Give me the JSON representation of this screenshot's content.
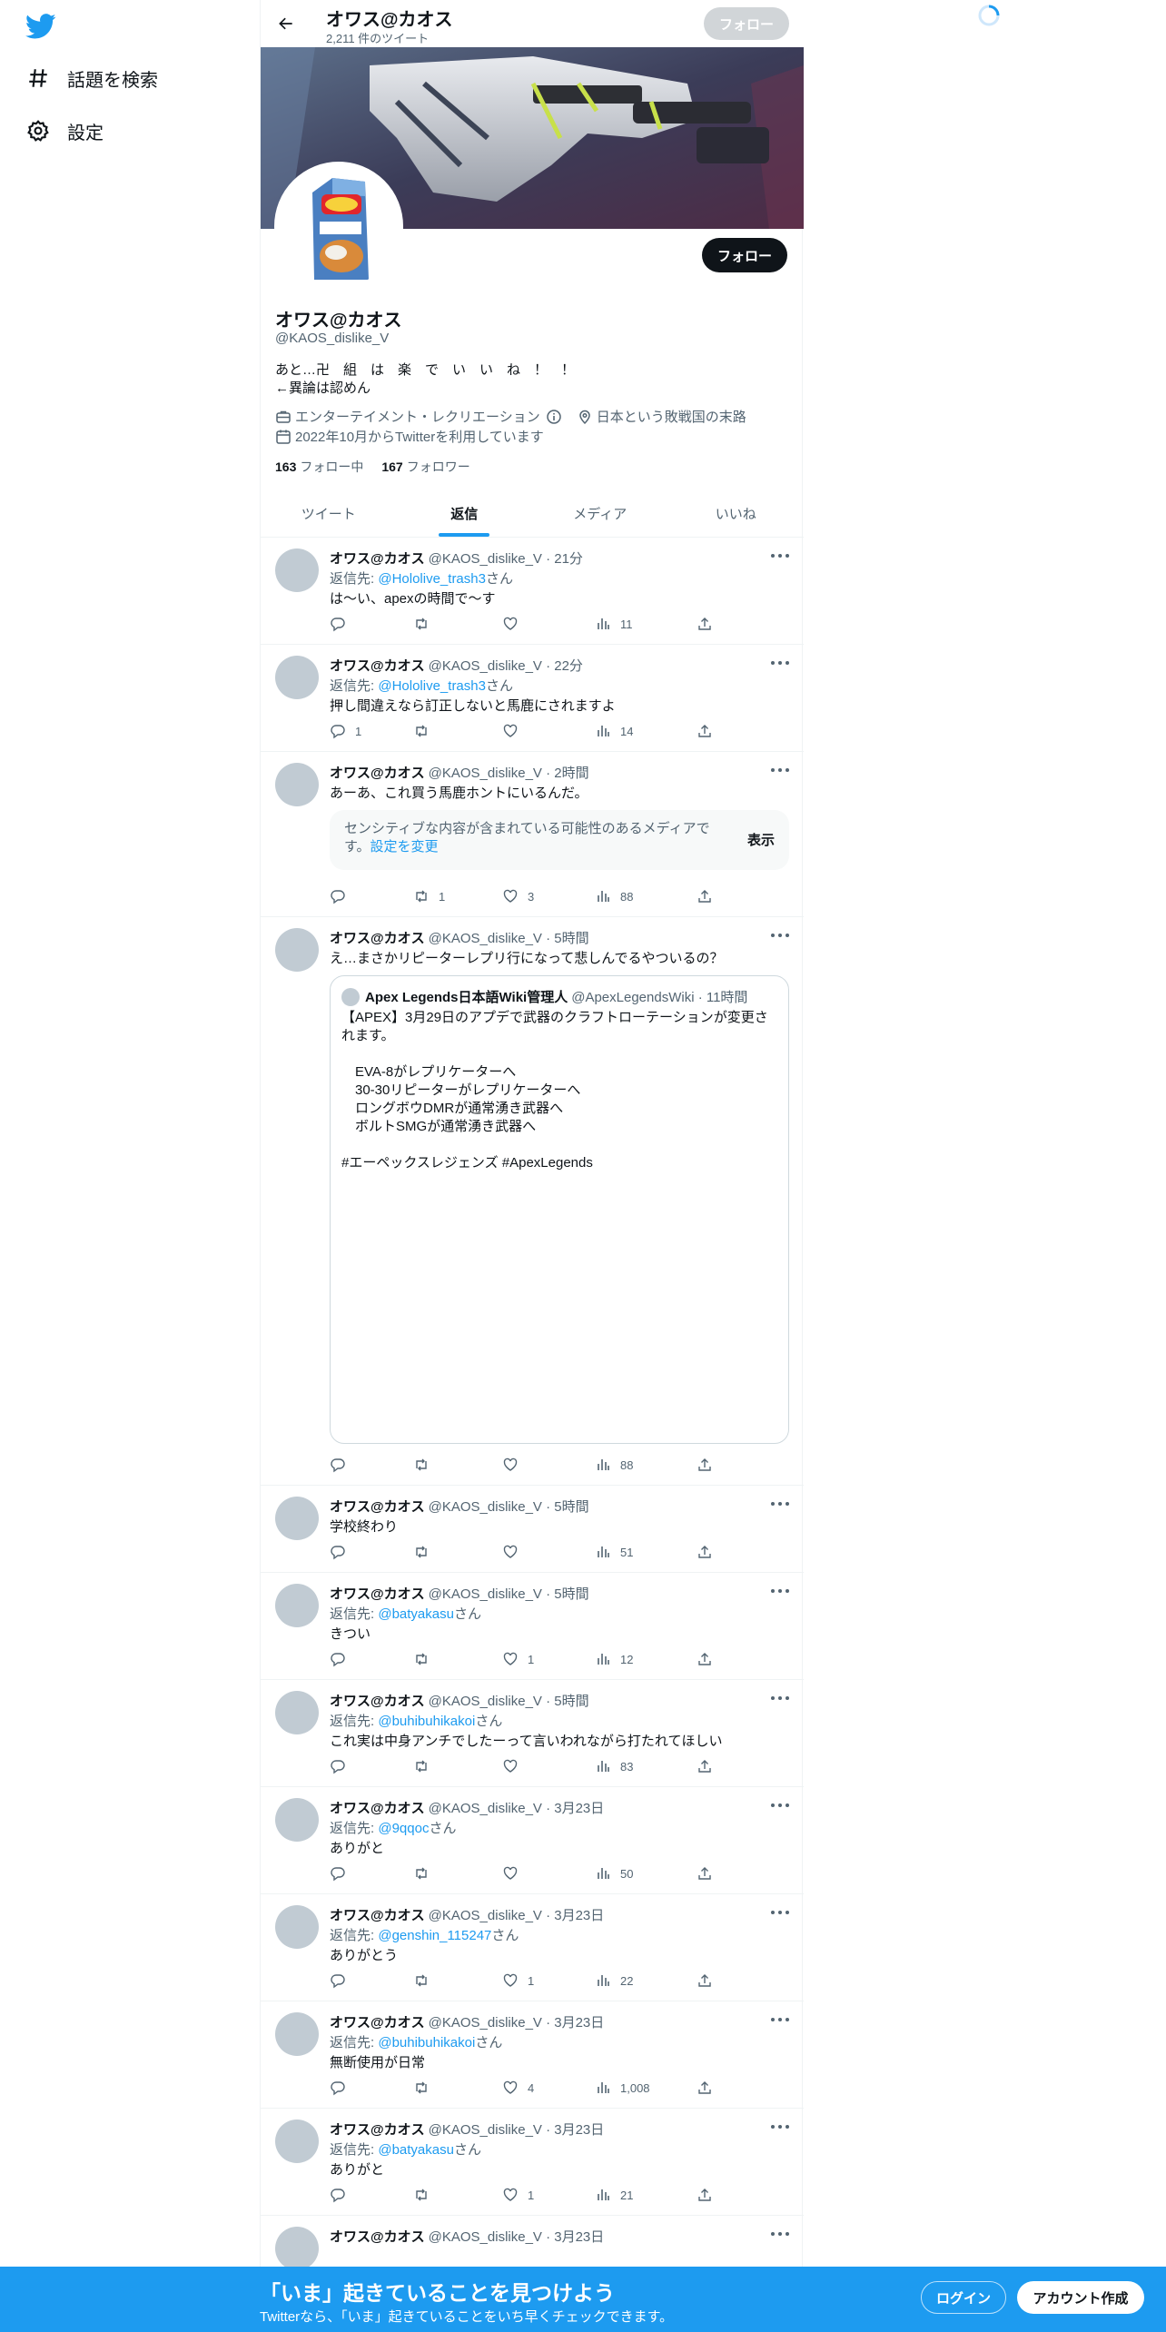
{
  "sidebar": {
    "logo": "twitter-bird-icon",
    "items": [
      {
        "label": "話題を検索",
        "icon": "hashtag-icon"
      },
      {
        "label": "設定",
        "icon": "gear-icon"
      }
    ]
  },
  "header": {
    "title": "オワス@カオス",
    "tweet_count": "2,211 件のツイート",
    "follow_label": "フォロー"
  },
  "profile": {
    "name": "オワス@カオス",
    "handle": "@KAOS_dislike_V",
    "follow_label": "フォロー",
    "bio": [
      "あと…卍　組　は　楽　で　い　い　ね　！　！",
      "←異論は認めん"
    ],
    "category": "エンターテイメント・レクリエーション",
    "location": "日本という敗戦国の末路",
    "joined": "2022年10月からTwitterを利用しています",
    "following_count": "163",
    "following_label": "フォロー中",
    "followers_count": "167",
    "followers_label": "フォロワー"
  },
  "tabs": [
    {
      "label": "ツイート",
      "active": false
    },
    {
      "label": "返信",
      "active": true
    },
    {
      "label": "メディア",
      "active": false
    },
    {
      "label": "いいね",
      "active": false
    }
  ],
  "reply_prefix": "返信先: ",
  "reply_suffix": "さん",
  "tweets": [
    {
      "name": "オワス@カオス",
      "meta": "@KAOS_dislike_V · 21分",
      "reply_to": "@Hololive_trash3",
      "text": "は〜い、apexの時間で〜す",
      "replies": "",
      "retweets": "",
      "likes": "",
      "views": "11"
    },
    {
      "name": "オワス@カオス",
      "meta": "@KAOS_dislike_V · 22分",
      "reply_to": "@Hololive_trash3",
      "text": "押し間違えなら訂正しないと馬鹿にされますよ",
      "replies": "1",
      "retweets": "",
      "likes": "",
      "views": "14"
    },
    {
      "name": "オワス@カオス",
      "meta": "@KAOS_dislike_V · 2時間",
      "reply_to": "",
      "text": "あーあ、これ買う馬鹿ホントにいるんだ。",
      "replies": "",
      "retweets": "1",
      "likes": "3",
      "views": "88",
      "sensitive": {
        "text": "センシティブな内容が含まれている可能性のあるメディアです。",
        "link": "設定を変更",
        "button": "表示"
      }
    },
    {
      "name": "オワス@カオス",
      "meta": "@KAOS_dislike_V · 5時間",
      "reply_to": "",
      "text": "え…まさかリピーターレプリ行になって悲しんでるやついるの？",
      "replies": "",
      "retweets": "",
      "likes": "",
      "views": "88",
      "quote": {
        "name": "Apex Legends日本語Wiki管理人",
        "meta": "@ApexLegendsWiki · 11時間",
        "lines": [
          "【APEX】3月29日のアプデで武器のクラフトローテーションが変更されます。",
          "",
          "　EVA-8がレプリケーターへ",
          "　30-30リピーターがレプリケーターへ",
          "　ロングボウDMRが通常湧き武器へ",
          "　ボルトSMGが通常湧き武器へ",
          "",
          "#エーペックスレジェンズ #ApexLegends"
        ]
      }
    },
    {
      "name": "オワス@カオス",
      "meta": "@KAOS_dislike_V · 5時間",
      "reply_to": "",
      "text": "学校終わり",
      "replies": "",
      "retweets": "",
      "likes": "",
      "views": "51"
    },
    {
      "name": "オワス@カオス",
      "meta": "@KAOS_dislike_V · 5時間",
      "reply_to": "@batyakasu",
      "text": "きつい",
      "replies": "",
      "retweets": "",
      "likes": "1",
      "views": "12"
    },
    {
      "name": "オワス@カオス",
      "meta": "@KAOS_dislike_V · 5時間",
      "reply_to": "@buhibuhikakoi",
      "text": "これ実は中身アンチでしたーって言いわれながら打たれてほしい",
      "replies": "",
      "retweets": "",
      "likes": "",
      "views": "83"
    },
    {
      "name": "オワス@カオス",
      "meta": "@KAOS_dislike_V · 3月23日",
      "reply_to": "@9qqoc",
      "text": "ありがと",
      "replies": "",
      "retweets": "",
      "likes": "",
      "views": "50"
    },
    {
      "name": "オワス@カオス",
      "meta": "@KAOS_dislike_V · 3月23日",
      "reply_to": "@genshin_115247",
      "text": "ありがとう",
      "replies": "",
      "retweets": "",
      "likes": "1",
      "views": "22"
    },
    {
      "name": "オワス@カオス",
      "meta": "@KAOS_dislike_V · 3月23日",
      "reply_to": "@buhibuhikakoi",
      "text": "無断使用が日常",
      "replies": "",
      "retweets": "",
      "likes": "4",
      "views": "1,008"
    },
    {
      "name": "オワス@カオス",
      "meta": "@KAOS_dislike_V · 3月23日",
      "reply_to": "@batyakasu",
      "text": "ありがと",
      "replies": "",
      "retweets": "",
      "likes": "1",
      "views": "21"
    },
    {
      "name": "オワス@カオス",
      "meta": "@KAOS_dislike_V · 3月23日",
      "reply_to": "",
      "text": "",
      "replies": "",
      "retweets": "",
      "likes": "",
      "views": ""
    }
  ],
  "bottom_bar": {
    "title": "「いま」起きていることを見つけよう",
    "subtitle": "Twitterなら、「いま」起きていることをいち早くチェックできます。",
    "login": "ログイン",
    "signup": "アカウント作成"
  },
  "colors": {
    "accent": "#1d9bf0",
    "text": "#0f1419",
    "muted": "#536471",
    "border": "#eff3f4"
  }
}
